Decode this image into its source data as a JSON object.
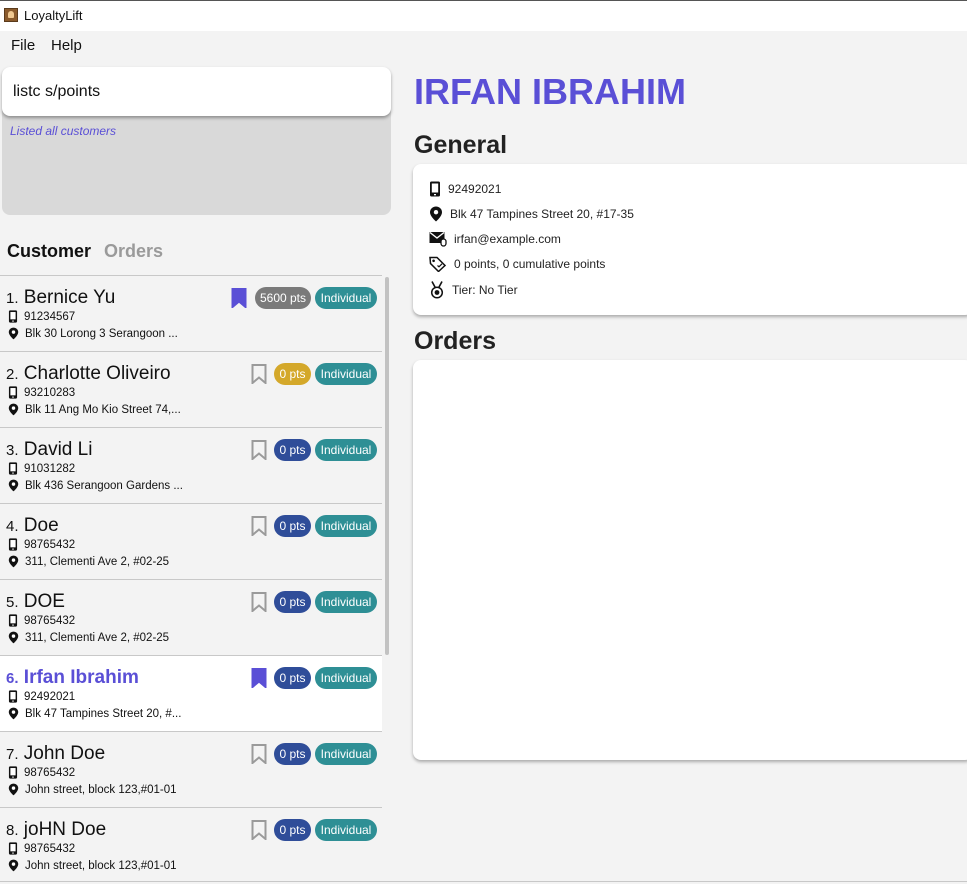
{
  "window": {
    "title": "LoyaltyLift"
  },
  "menu": [
    "File",
    "Help"
  ],
  "command": {
    "value": "listc s/points",
    "result": "Listed all customers"
  },
  "tabs": [
    {
      "label": "Customer",
      "active": true
    },
    {
      "label": "Orders",
      "active": false
    }
  ],
  "customers": [
    {
      "index": "1.",
      "name": "Bernice Yu",
      "phone": "91234567",
      "address": "Blk 30 Lorong 3 Serangoon ...",
      "bookmarked": true,
      "points": "5600 pts",
      "points_color": "#7a7a7a",
      "type": "Individual",
      "selected": false
    },
    {
      "index": "2.",
      "name": "Charlotte Oliveiro",
      "phone": "93210283",
      "address": "Blk 11 Ang Mo Kio Street 74,...",
      "bookmarked": false,
      "points": "0 pts",
      "points_color": "#d4a82a",
      "type": "Individual",
      "selected": false
    },
    {
      "index": "3.",
      "name": "David Li",
      "phone": "91031282",
      "address": "Blk 436 Serangoon Gardens ...",
      "bookmarked": false,
      "points": "0 pts",
      "points_color": "#2f4d99",
      "type": "Individual",
      "selected": false
    },
    {
      "index": "4.",
      "name": "Doe",
      "phone": "98765432",
      "address": "311, Clementi Ave 2, #02-25",
      "bookmarked": false,
      "points": "0 pts",
      "points_color": "#2f4d99",
      "type": "Individual",
      "selected": false
    },
    {
      "index": "5.",
      "name": "DOE",
      "phone": "98765432",
      "address": "311, Clementi Ave 2, #02-25",
      "bookmarked": false,
      "points": "0 pts",
      "points_color": "#2f4d99",
      "type": "Individual",
      "selected": false
    },
    {
      "index": "6.",
      "name": "Irfan Ibrahim",
      "phone": "92492021",
      "address": "Blk 47 Tampines Street 20, #...",
      "bookmarked": true,
      "points": "0 pts",
      "points_color": "#2f4d99",
      "type": "Individual",
      "selected": true
    },
    {
      "index": "7.",
      "name": "John Doe",
      "phone": "98765432",
      "address": "John street, block 123,#01-01",
      "bookmarked": false,
      "points": "0 pts",
      "points_color": "#2f4d99",
      "type": "Individual",
      "selected": false
    },
    {
      "index": "8.",
      "name": "joHN Doe",
      "phone": "98765432",
      "address": "John street, block 123,#01-01",
      "bookmarked": false,
      "points": "0 pts",
      "points_color": "#2f4d99",
      "type": "Individual",
      "selected": false
    }
  ],
  "detail": {
    "name": "IRFAN IBRAHIM",
    "general_heading": "General",
    "phone": "92492021",
    "address": "Blk 47 Tampines Street 20, #17-35",
    "email": "irfan@example.com",
    "points": "0 points, 0 cumulative points",
    "tier": "Tier: No Tier",
    "orders_heading": "Orders"
  },
  "colors": {
    "accent": "#5a4fd6",
    "individual_badge": "#2e8f95"
  }
}
